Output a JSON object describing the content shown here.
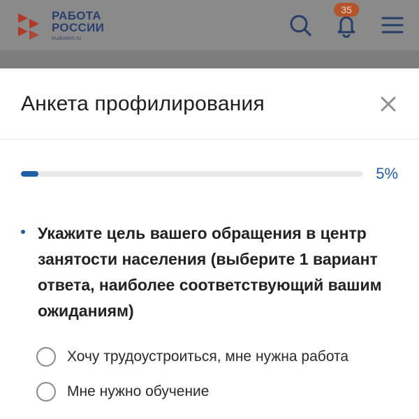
{
  "header": {
    "logo": {
      "line1": "РАБОТА",
      "line2": "РОССИИ",
      "domain": "trudvsem.ru",
      "colors": {
        "red": "#c7402d",
        "navy": "#2a3f6b"
      }
    },
    "icons": [
      "search-icon",
      "bell-icon",
      "menu-icon"
    ],
    "notifications_count": "35"
  },
  "modal": {
    "title": "Анкета профилирования",
    "close_icon": "close-icon",
    "progress": {
      "percent": 5,
      "label": "5%",
      "color": "#1f5fa8"
    },
    "question": {
      "text": "Укажите цель вашего обращения в центр занятости населения (выберите 1 вариант ответа, наиболее соответствующий вашим ожиданиям)"
    },
    "options": [
      {
        "label": "Хочу трудоустроиться, мне нужна работа",
        "selected": false
      },
      {
        "label": "Мне нужно обучение",
        "selected": false
      }
    ]
  }
}
